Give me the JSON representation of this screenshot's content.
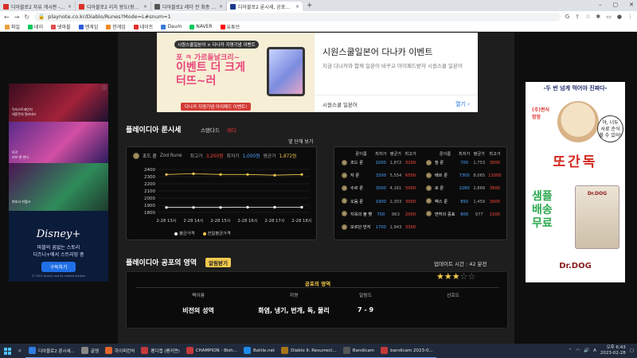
{
  "browser": {
    "tabs": [
      {
        "title": "디아블로2 자유 게시판 - 디아블...",
        "color": "#d93025",
        "active": false
      },
      {
        "title": "디아블로2 리치 왕도(왕세이드 ...",
        "color": "#d93025",
        "active": false
      },
      {
        "title": "디아블로2 레더 전 최종 흐름...",
        "color": "#555555",
        "active": false
      },
      {
        "title": "디아블로2 룬시세, 공포의영역 ...",
        "color": "#1a3a8c",
        "active": true
      }
    ],
    "new_tab": "+",
    "url": "playnote.co.kr/Diablo/Runes?Mode=L#snum=1",
    "bookmarks": [
      {
        "label": "파일",
        "color": "#e8a23a"
      },
      {
        "label": "네이",
        "color": "#03c75a"
      },
      {
        "label": "넷마블",
        "color": "#e24b4b"
      },
      {
        "label": "엔게임",
        "color": "#2b5bd7"
      },
      {
        "label": "한게임",
        "color": "#f08a24"
      },
      {
        "label": "네이트",
        "color": "#e0302c"
      },
      {
        "label": "Daum",
        "color": "#3a7bd5"
      },
      {
        "label": "NAVER",
        "color": "#03c75a"
      },
      {
        "label": "유튜브",
        "color": "#ff0000"
      }
    ]
  },
  "ad_left": {
    "close": "ⓘ",
    "poster1_line": "닥터스트레인지\n대혼돈의 멀티버스",
    "poster2_line": "토르\n러브 앤 썬더",
    "poster3_line": "변호사 쉬헐크",
    "logo": "Disney+",
    "line1": "마블의 꿈없는 스토리",
    "line2": "디즈니+에서 스트리밍 중",
    "button": "구독하기",
    "fine": "© 2022 Disney and its related entities"
  },
  "ad_top": {
    "badge": "시원스쿨일본어 × 다나카 지명기념 이벤트",
    "line1": "포 ㅋ 가르돌날크리~",
    "line2": "이벤트 더 크게\n터뜨~러",
    "bar": "다나카 지명기념 아이패드 이벤트!",
    "headline": "시원스쿨일본어 다나카 이벤트",
    "sub": "지금 다나카와 함께 일본어 바꾸고 아이패드받자 시원스쿨 일본어",
    "advertiser": "시원스쿨 일본어",
    "cta": "열기 ›"
  },
  "ad_right": {
    "top": "-두 번 넘게 먹어야 진짜다-",
    "sub": "(주)펀식\n멍멍",
    "speech": "야, 너두\n사료 순식\n할 수 있어!",
    "red": "또간독",
    "green": "샘플\n배송\n무료",
    "bag": "Dr.DOG",
    "bottom": "Dr.DOG"
  },
  "runes": {
    "title": "플레이디아 룬시세",
    "standard": "스탠다드",
    "ladder": "래더",
    "single_view": "옆 단해 보기",
    "chart_label": "조드 룬",
    "chart_name": "Zod Rune",
    "max_label": "최고가",
    "max_value": "3,200원",
    "min_label": "최저가",
    "min_value": "1,000원",
    "avg_label": "평균가",
    "avg_value": "1,872원",
    "legend_avg": "평균가격",
    "legend_prev": "전일평균가격"
  },
  "chart_data": {
    "type": "line",
    "title": "",
    "x": [
      "2-28 13시",
      "2-28 14시",
      "2-28 15시",
      "2-28 16시",
      "2-28 17시",
      "2-28 18시"
    ],
    "ylim": [
      1800,
      2400
    ],
    "yticks": [
      1800,
      1900,
      2000,
      2100,
      2200,
      2300,
      2400
    ],
    "series": [
      {
        "name": "평균가격",
        "values": [
          1870,
          1870,
          1870,
          1872,
          1872,
          1872
        ]
      },
      {
        "name": "전일평균가격",
        "values": [
          2330,
          2340,
          2330,
          2330,
          2320,
          2330
        ]
      }
    ],
    "colors": [
      "#ffffff",
      "#f2c94c"
    ],
    "grid": true
  },
  "rune_table": {
    "headers": [
      "룬이름",
      "최저가",
      "평균가",
      "최고가"
    ],
    "left": [
      {
        "name": "조드 룬",
        "min": "1000",
        "avg": "1,872",
        "max": "3200"
      },
      {
        "name": "자 룬",
        "min": "3300",
        "avg": "5,554",
        "max": "6500"
      },
      {
        "name": "수르 룬",
        "min": "3000",
        "avg": "4,161",
        "max": "5000"
      },
      {
        "name": "오움 룬",
        "min": "1900",
        "avg": "2,303",
        "max": "3000"
      },
      {
        "name": "지옥의 불 횃",
        "min": "700",
        "avg": "863",
        "max": "2000"
      },
      {
        "name": "모르단 반지",
        "min": "1700",
        "avg": "1,943",
        "max": "3300"
      }
    ],
    "right": [
      {
        "name": "참 룬",
        "min": "700",
        "avg": "1,753",
        "max": "3000"
      },
      {
        "name": "베르 룬",
        "min": "7300",
        "avg": "8,065",
        "max": "11000"
      },
      {
        "name": "로 룬",
        "min": "2280",
        "avg": "2,869",
        "max": "3900"
      },
      {
        "name": "벡스 룬",
        "min": "850",
        "avg": "1,459",
        "max": "3900"
      },
      {
        "name": "면허의 증표",
        "min": "800",
        "avg": "977",
        "max": "1500"
      }
    ]
  },
  "terror": {
    "title": "플레이디아 공포의 영역",
    "alarm": "알림받기",
    "update": "업데이트 시간 : 42 분전",
    "box_title": "공포의 영역",
    "headers": [
      "팩이름",
      "지명",
      "알림도",
      "선호도"
    ],
    "values": [
      "비전의 성역",
      "화염, 냉기, 번개, 독, 물리",
      "7 - 9"
    ],
    "rating": 3,
    "rating_max": 5
  },
  "taskbar": {
    "items": [
      {
        "label": "디아블로2 룬시세...",
        "color": "#2f7de1"
      },
      {
        "label": "골렘",
        "color": "#888888"
      },
      {
        "label": "하이퍼런처",
        "color": "#e0642c"
      },
      {
        "label": "펜디캡 (펜카면)",
        "color": "#c43a3a"
      },
      {
        "label": "CHAMPION - Bish...",
        "color": "#c43a3a"
      },
      {
        "label": "Battle.net",
        "color": "#1f8ae8"
      },
      {
        "label": "Diablo II: Resurrect...",
        "color": "#a8741a"
      },
      {
        "label": "Bandicam",
        "color": "#555555"
      },
      {
        "label": "bandicam 2023-0...",
        "color": "#c43a3a"
      }
    ],
    "lang": "A",
    "time": "오후 6:43",
    "date": "2023-02-28"
  }
}
